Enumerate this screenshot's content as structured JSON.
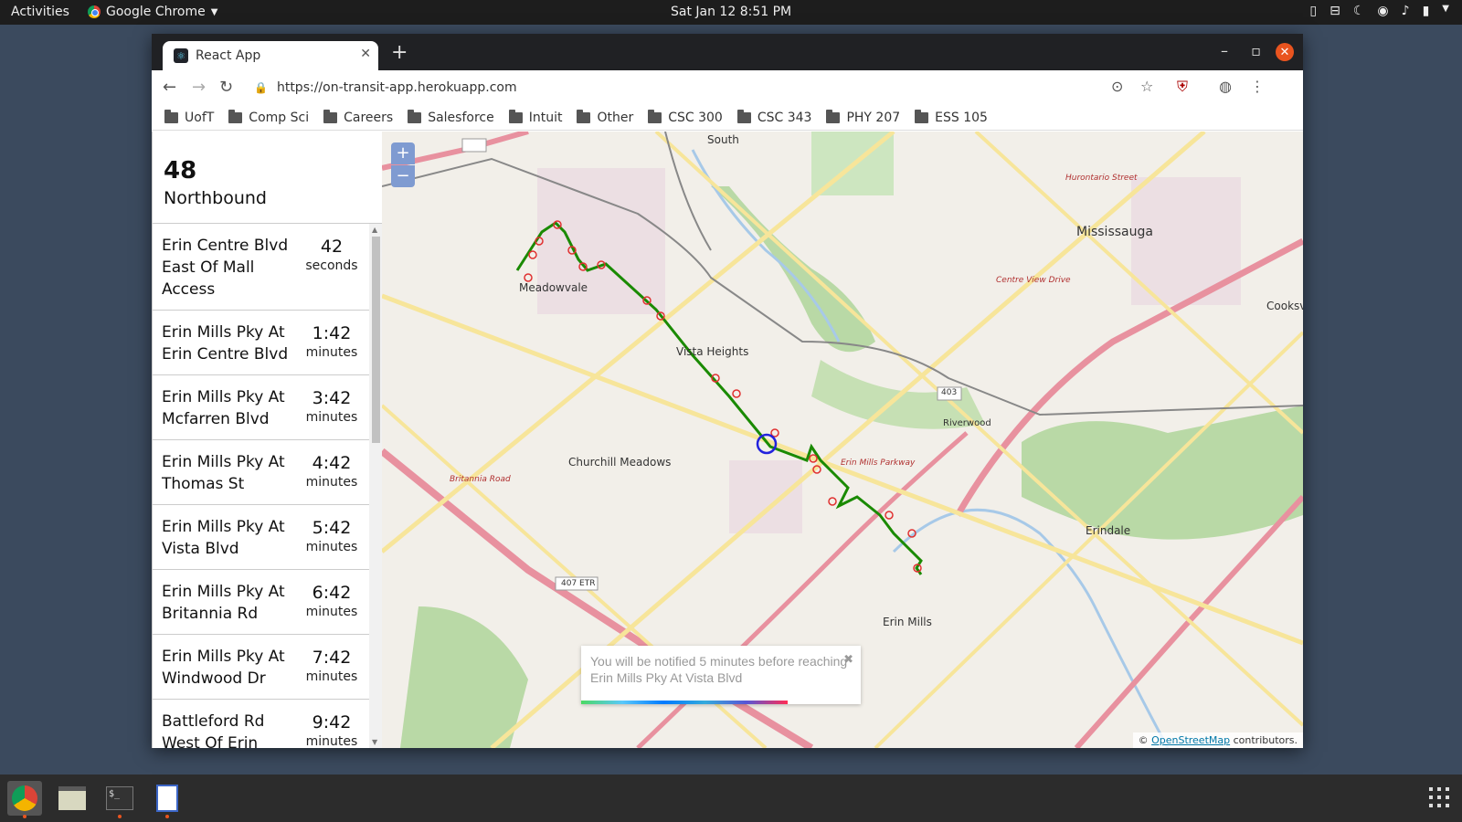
{
  "topbar": {
    "activities": "Activities",
    "app_name": "Google Chrome",
    "clock": "Sat Jan 12   8:51 PM"
  },
  "browser": {
    "tab_title": "React App",
    "url": "https://on-transit-app.herokuapp.com",
    "bookmarks": [
      "UofT",
      "Comp Sci",
      "Careers",
      "Salesforce",
      "Intuit",
      "Other",
      "CSC 300",
      "CSC 343",
      "PHY 207",
      "ESS 105"
    ]
  },
  "route": {
    "number": "48",
    "direction": "Northbound"
  },
  "stops": [
    {
      "name": "Erin Centre Blvd East Of Mall Access",
      "eta": "42",
      "unit": "seconds"
    },
    {
      "name": "Erin Mills Pky At Erin Centre Blvd",
      "eta": "1:42",
      "unit": "minutes"
    },
    {
      "name": "Erin Mills Pky At Mcfarren Blvd",
      "eta": "3:42",
      "unit": "minutes"
    },
    {
      "name": "Erin Mills Pky At Thomas St",
      "eta": "4:42",
      "unit": "minutes"
    },
    {
      "name": "Erin Mills Pky At Vista Blvd",
      "eta": "5:42",
      "unit": "minutes"
    },
    {
      "name": "Erin Mills Pky At Britannia Rd",
      "eta": "6:42",
      "unit": "minutes"
    },
    {
      "name": "Erin Mills Pky At Windwood Dr",
      "eta": "7:42",
      "unit": "minutes"
    },
    {
      "name": "Battleford Rd West Of Erin Mills",
      "eta": "9:42",
      "unit": "minutes"
    }
  ],
  "map": {
    "zoom_in": "+",
    "zoom_out": "−",
    "labels": {
      "mississauga": "Mississauga",
      "meadowvale": "Meadowvale",
      "vista_heights": "Vista Heights",
      "churchill_meadows": "Churchill Meadows",
      "erin_mills": "Erin Mills",
      "erindale": "Erindale",
      "riverwood": "Riverwood",
      "south": "South",
      "cooksville": "Cooksvi",
      "etr407": "407 ETR",
      "hwy403": "403",
      "erin_mills_parkway": "Erin Mills Parkway",
      "britannia_road": "Britannia Road",
      "hurontario": "Hurontario Street",
      "centre_view": "Centre View Drive"
    },
    "attribution_prefix": "©",
    "attribution_link": "OpenStreetMap",
    "attribution_suffix": "contributors.",
    "route_color": "#1a8a00",
    "stop_color": "#e03030"
  },
  "toast": {
    "message": "You will be notified 5 minutes before reaching Erin Mills Pky At Vista Blvd",
    "close": "✖",
    "progress": 0.74
  }
}
